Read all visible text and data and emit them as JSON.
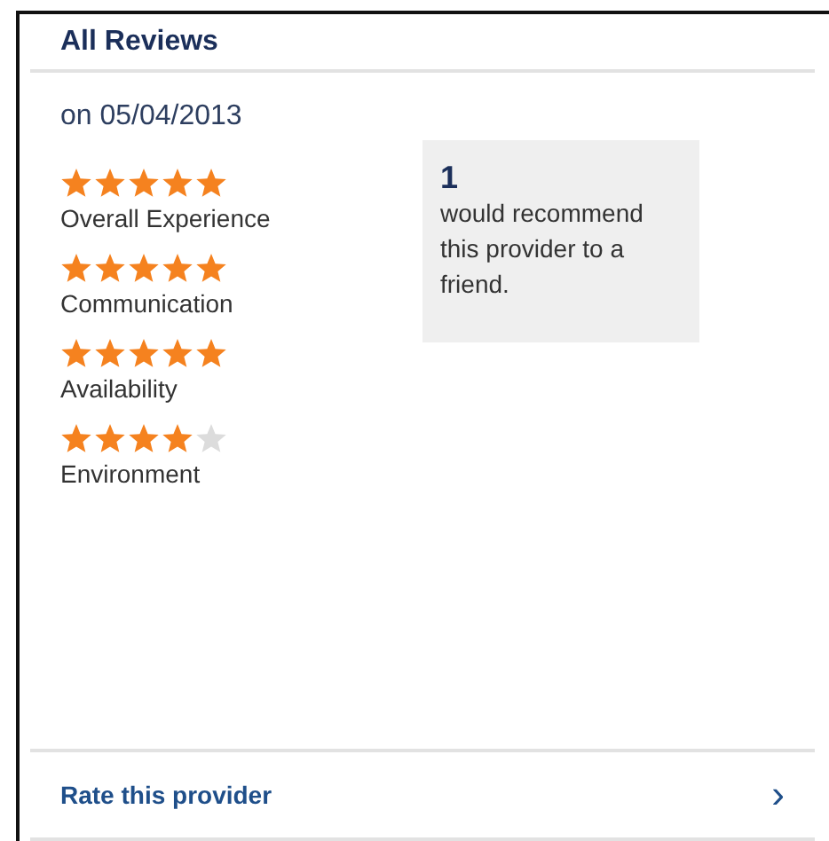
{
  "title": "All Reviews",
  "date": "on 05/04/2013",
  "ratings": [
    {
      "label": "Overall Experience",
      "stars": 5
    },
    {
      "label": "Communication",
      "stars": 5
    },
    {
      "label": "Availability",
      "stars": 5
    },
    {
      "label": "Environment",
      "stars": 4
    }
  ],
  "recommend": {
    "count": "1",
    "text": "would recommend this provider to a friend."
  },
  "rate_link": {
    "label": "Rate this provider",
    "chevron": "›"
  }
}
